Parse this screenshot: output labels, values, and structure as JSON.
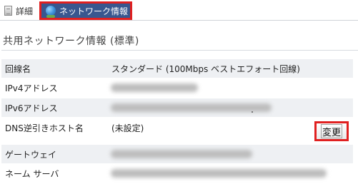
{
  "tabs": [
    {
      "label": "詳細",
      "icon": "document-icon",
      "active": false
    },
    {
      "label": "ネットワーク情報",
      "icon": "globe-icon",
      "active": true
    }
  ],
  "section": {
    "title": "共用ネットワーク情報 (標準)"
  },
  "rows": [
    {
      "label": "回線名",
      "value": "スタンダード (100Mbps ベストエフォート回線)"
    },
    {
      "label": "IPv4アドレス",
      "value": ""
    },
    {
      "label": "IPv6アドレス",
      "value": ""
    },
    {
      "label": "DNS逆引きホスト名",
      "value": "(未設定)",
      "button": "変更"
    },
    {
      "label": "ゲートウェイ",
      "value": ""
    },
    {
      "label": "ネーム サーバ",
      "value": ""
    }
  ],
  "colors": {
    "active_tab_bg": "#38578f",
    "highlight_border": "#e02020",
    "alt_row_bg": "#eef0f3"
  }
}
